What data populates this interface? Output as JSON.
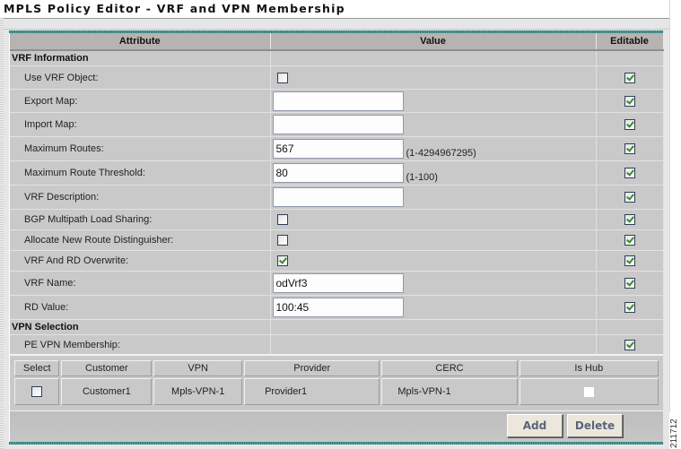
{
  "window": {
    "title": "MPLS Policy Editor - VRF and VPN Membership"
  },
  "attributes_table": {
    "headers": {
      "attribute": "Attribute",
      "value": "Value",
      "editable": "Editable"
    },
    "sections": {
      "vrf_information": "VRF Information",
      "vpn_selection": "VPN Selection"
    },
    "rows": {
      "use_vrf_object": {
        "label": "Use VRF Object:",
        "checked": false,
        "editable": true
      },
      "export_map": {
        "label": "Export Map:",
        "value": "",
        "editable": true
      },
      "import_map": {
        "label": "Import Map:",
        "value": "",
        "editable": true
      },
      "maximum_routes": {
        "label": "Maximum Routes:",
        "value": "567",
        "hint": "(1-4294967295)",
        "editable": true
      },
      "maximum_route_threshold": {
        "label": "Maximum Route Threshold:",
        "value": "80",
        "hint": "(1-100)",
        "editable": true
      },
      "vrf_description": {
        "label": "VRF Description:",
        "value": "",
        "editable": true
      },
      "bgp_multipath": {
        "label": "BGP Multipath Load Sharing:",
        "checked": false,
        "editable": true
      },
      "allocate_new_rd": {
        "label": "Allocate New Route Distinguisher:",
        "checked": false,
        "editable": true
      },
      "vrf_rd_overwrite": {
        "label": "VRF And RD Overwrite:",
        "checked": true,
        "editable": true
      },
      "vrf_name": {
        "label": "VRF Name:",
        "value": "odVrf3",
        "editable": true
      },
      "rd_value": {
        "label": "RD Value:",
        "value": "100:45",
        "editable": true
      },
      "pe_vpn_membership": {
        "label": "PE VPN Membership:",
        "editable": true
      }
    }
  },
  "vpn_table": {
    "headers": [
      "Select",
      "Customer",
      "VPN",
      "Provider",
      "CERC",
      "Is Hub"
    ],
    "rows": [
      {
        "selected": false,
        "customer": "Customer1",
        "vpn": "Mpls-VPN-1",
        "provider": "Provider1",
        "cerc": "Mpls-VPN-1",
        "is_hub": false
      }
    ]
  },
  "buttons": {
    "add": "Add",
    "delete": "Delete"
  },
  "figure_id": "211712"
}
